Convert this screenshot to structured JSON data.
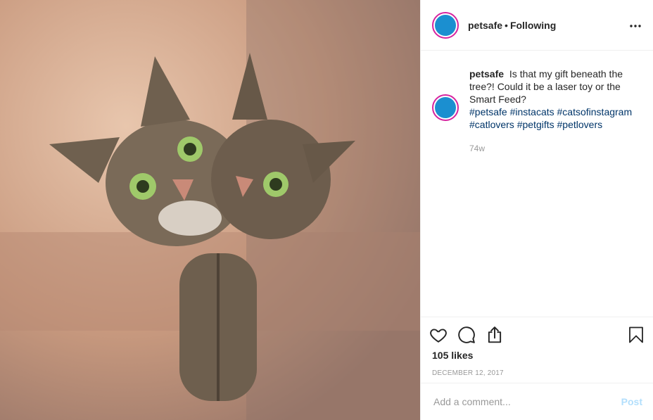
{
  "post": {
    "author": "petsafe",
    "separator": "•",
    "follow_status": "Following",
    "more_icon": "more-options-icon",
    "avatar_text": "PetSafe",
    "caption": "Is that my gift beneath the tree?! Could it be a laser toy or the Smart Feed?",
    "hashtags": "#petsafe #instacats #catsofinstagram #catlovers #petgifts #petlovers",
    "time_ago": "74w",
    "likes": "105 likes",
    "date": "DECEMBER 12, 2017",
    "comment_placeholder": "Add a comment...",
    "post_label": "Post"
  },
  "colors": {
    "link": "#003569",
    "muted": "#999999",
    "post_disabled": "#b2dffc",
    "avatar_ring": "#d6249f",
    "avatar_fill": "#1b8fd0"
  },
  "icons": [
    "heart-icon",
    "comment-icon",
    "share-icon",
    "bookmark-icon"
  ]
}
